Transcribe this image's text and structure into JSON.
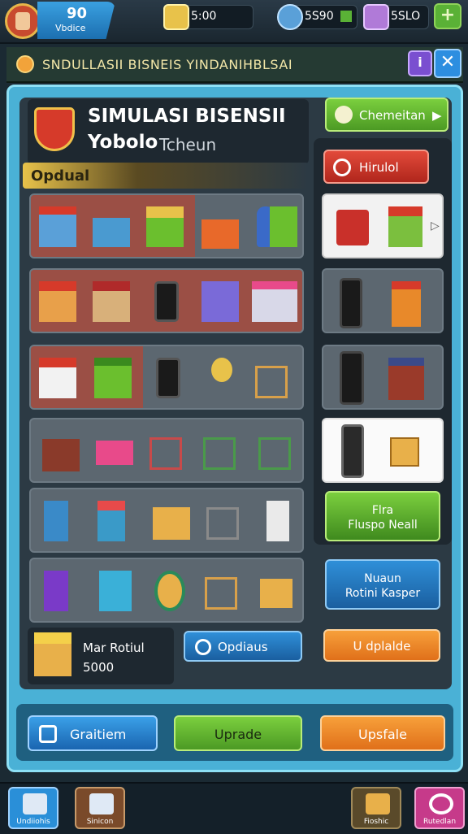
{
  "topbar": {
    "level_value": "90",
    "level_label": "Vbdice",
    "resources": [
      {
        "icon": "coin-icon",
        "value": "5:00",
        "color": "#e8c24a"
      },
      {
        "icon": "gem-icon",
        "value": "5S90",
        "color": "#5aa0d8"
      },
      {
        "icon": "cash-icon",
        "value": "5SLO",
        "color": "#b07ad8"
      }
    ],
    "plus_label": "+"
  },
  "titlebar": {
    "title": "SNDULLASII BISNEIS YINDANIHBLSAI",
    "info_label": "i",
    "close_label": "✕"
  },
  "header": {
    "title_line1": "SIMULASI BISENSII",
    "title_line2": "Yobolo",
    "title_line2b": "Tcheun",
    "section_label": "Opdual"
  },
  "side": {
    "top_button": "Chemeitan",
    "tab_label": "Hirulol",
    "green_card": {
      "line1": "Flra",
      "line2": "Fluspo Neall"
    },
    "blue_card": {
      "line1": "Nuaun",
      "line2": "Rotini Kasper"
    }
  },
  "featured": {
    "line1": "Mar Rotiul",
    "line2": "5000",
    "button": "Opdiaus",
    "orange_button": "U dplalde"
  },
  "bottom_buttons": [
    {
      "label": "Graitiem",
      "color": "#2f8fd8"
    },
    {
      "label": "Uprade",
      "color": "#6bbf2e"
    },
    {
      "label": "Upsfale",
      "color": "#f08a1c"
    }
  ],
  "footer_tabs": [
    {
      "label": "Undiiohis",
      "icon": "store-icon",
      "color": "#2a8fd8"
    },
    {
      "label": "Sinicon",
      "icon": "box-icon",
      "color": "#7a4a2a"
    },
    {
      "label": "Fioshic",
      "icon": "bag-icon",
      "color": "#5a4a2a"
    },
    {
      "label": "Rutedlan",
      "icon": "refresh-icon",
      "color": "#c63a8a"
    }
  ]
}
